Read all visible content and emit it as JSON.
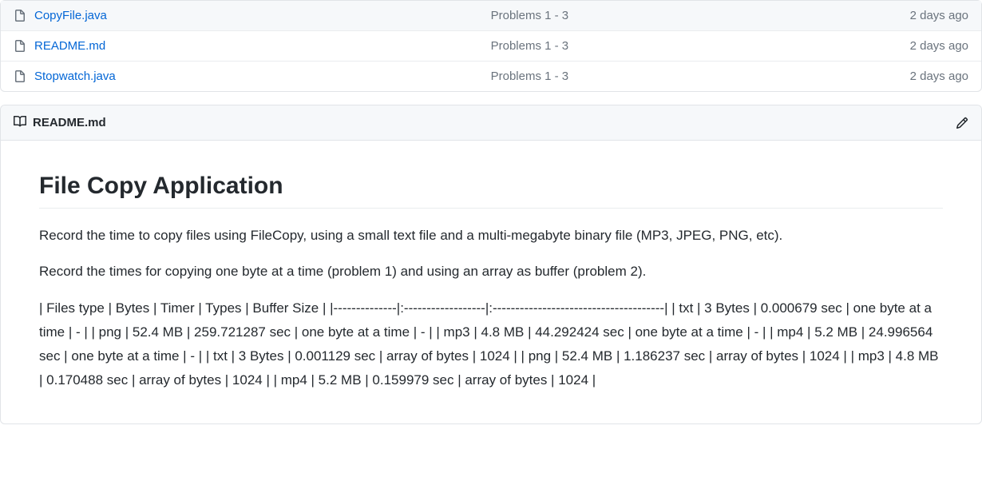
{
  "files": [
    {
      "name": "CopyFile.java",
      "message": "Problems 1 - 3",
      "time": "2 days ago"
    },
    {
      "name": "README.md",
      "message": "Problems 1 - 3",
      "time": "2 days ago"
    },
    {
      "name": "Stopwatch.java",
      "message": "Problems 1 - 3",
      "time": "2 days ago"
    }
  ],
  "readme": {
    "header_title": "README.md",
    "heading": "File Copy Application",
    "paragraph1": "Record the time to copy files using FileCopy, using a small text file and a multi-megabyte binary file (MP3, JPEG, PNG, etc).",
    "paragraph2": "Record the times for copying one byte at a time (problem 1) and using an array as buffer (problem 2).",
    "table_text": "| Files type | Bytes | Timer | Types | Buffer Size | |--------------|:------------------|:--------------------------------------| | txt | 3 Bytes | 0.000679 sec | one byte at a time | - | | png | 52.4 MB | 259.721287 sec | one byte at a time | - | | mp3 | 4.8 MB | 44.292424 sec | one byte at a time | - | | mp4 | 5.2 MB | 24.996564 sec | one byte at a time | - | | txt | 3 Bytes | 0.001129 sec | array of bytes | 1024 | | png | 52.4 MB | 1.186237 sec | array of bytes | 1024 | | mp3 | 4.8 MB | 0.170488 sec | array of bytes | 1024 | | mp4 | 5.2 MB | 0.159979 sec | array of bytes | 1024 |"
  }
}
